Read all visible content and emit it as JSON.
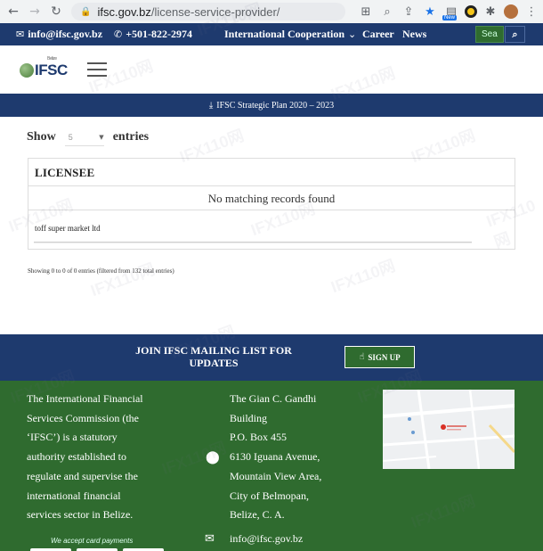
{
  "browser": {
    "url_host": "ifsc.gov.bz",
    "url_path": "/license-service-provider/",
    "new_badge": "New"
  },
  "topbar": {
    "email": "info@ifsc.gov.bz",
    "phone": "+501-822-2974",
    "nav": [
      "International Cooperation",
      "Career",
      "News"
    ],
    "search_placeholder": "Sea"
  },
  "header": {
    "logo_text": "IFSC",
    "logo_sub": "Belize"
  },
  "plan_link": "IFSC Strategic Plan 2020 – 2023",
  "table": {
    "show_label": "Show",
    "show_value": "5",
    "entries_label": "entries",
    "column": "LICENSEE",
    "empty_message": "No matching records found",
    "row": "toff super market ltd",
    "info": "Showing 0 to 0 of 0 entries (filtered from 132 total entries)"
  },
  "mailing": {
    "title": "JOIN IFSC MAILING LIST FOR UPDATES",
    "signup": "SIGN UP"
  },
  "footer": {
    "about_lines": [
      "The International Financial",
      "Services Commission (the",
      "‘IFSC’) is a statutory",
      "authority established to",
      "regulate and supervise the",
      "international financial",
      "services sector in Belize."
    ],
    "address_lines": [
      "The Gian C. Gandhi",
      "Building",
      "P.O. Box 455",
      "6130 Iguana Avenue,",
      "Mountain View Area,",
      "City of Belmopan,",
      "Belize, C. A."
    ],
    "email": "info@ifsc.gov.bz",
    "cards_label": "We accept card payments"
  },
  "watermark": "IFX110网",
  "colors": {
    "navy": "#1e3a6e",
    "green": "#2f6b2f"
  }
}
